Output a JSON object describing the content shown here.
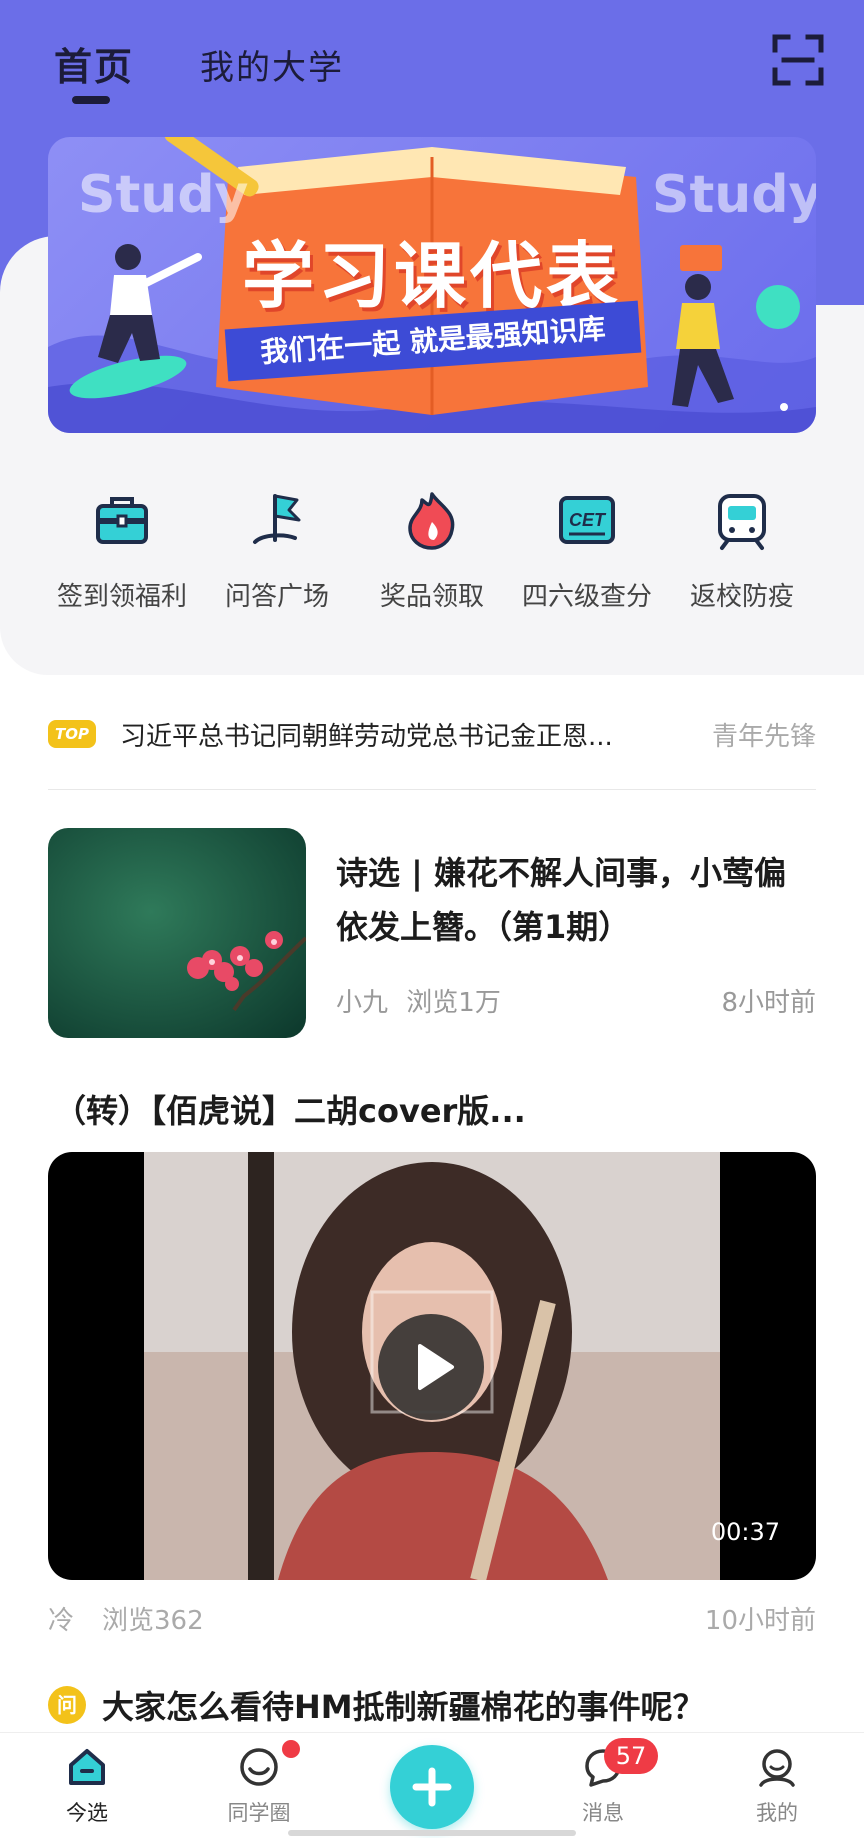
{
  "header": {
    "tabs": [
      {
        "label": "首页",
        "active": true
      },
      {
        "label": "我的大学",
        "active": false
      }
    ],
    "scan_icon": "scan-icon"
  },
  "banner": {
    "title": "学习课代表",
    "subtitle": "我们在一起  就是最强知识库",
    "bg_word_left": "Study",
    "bg_word_right": "Study"
  },
  "quick_actions": [
    {
      "label": "签到领福利",
      "icon": "briefcase-icon"
    },
    {
      "label": "问答广场",
      "icon": "flag-icon"
    },
    {
      "label": "奖品领取",
      "icon": "flame-icon"
    },
    {
      "label": "四六级查分",
      "icon": "cet-icon"
    },
    {
      "label": "返校防疫",
      "icon": "train-icon"
    }
  ],
  "top_news": {
    "badge": "TOP",
    "text": "习近平总书记同朝鲜劳动党总书记金正恩...",
    "source": "青年先锋"
  },
  "article": {
    "title": "诗选 | 嫌花不解人间事，小莺偏依发上簪。（第1期）",
    "author": "小九",
    "views": "浏览1万",
    "time": "8小时前"
  },
  "video_post": {
    "title": "（转）【佰虎说】二胡cover版...",
    "duration": "00:37",
    "author": "冷",
    "views": "浏览362",
    "time": "10小时前"
  },
  "question": {
    "badge": "问",
    "text": "大家怎么看待HM抵制新疆棉花的事件呢？"
  },
  "tabbar": {
    "items": [
      {
        "label": "今选",
        "active": true
      },
      {
        "label": "同学圈",
        "active": false
      },
      {
        "label": "消息",
        "active": false
      },
      {
        "label": "我的",
        "active": false
      }
    ],
    "message_count": "57"
  },
  "colors": {
    "header_bg": "#6b6ee8",
    "accent_teal": "#34d0d6",
    "badge_yellow": "#f3c21a",
    "badge_red": "#ef3b45"
  }
}
